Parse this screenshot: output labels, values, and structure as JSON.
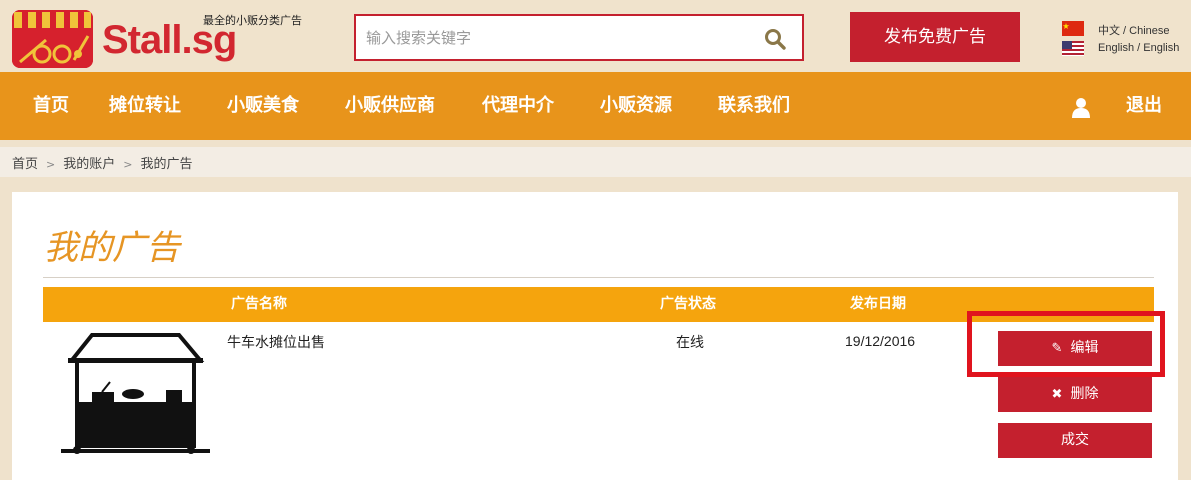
{
  "header": {
    "logo_text": "Stall.sg",
    "tagline": "最全的小贩分类广告",
    "search": {
      "placeholder": "输入搜索关键字",
      "value": ""
    },
    "post_button": "发布免费广告",
    "languages": [
      {
        "label": "中文 / Chinese",
        "flag": "china-flag-icon"
      },
      {
        "label": "English / English",
        "flag": "us-flag-icon"
      }
    ]
  },
  "nav": {
    "items": [
      "首页",
      "摊位转让",
      "小贩美食",
      "小贩供应商",
      "代理中介",
      "小贩资源",
      "联系我们"
    ],
    "logout": "退出"
  },
  "breadcrumb": [
    "首页",
    "我的账户",
    "我的广告"
  ],
  "page_title": "我的广告",
  "table": {
    "headers": [
      "广告名称",
      "广告状态",
      "发布日期"
    ],
    "rows": [
      {
        "name": "牛车水摊位出售",
        "status": "在线",
        "date": "19/12/2016",
        "actions": {
          "edit": "编辑",
          "delete": "删除",
          "done": "成交"
        }
      }
    ]
  },
  "colors": {
    "brand_red": "#c4202e",
    "nav_orange": "#e8941b",
    "table_head": "#f5a40d",
    "title_orange": "#e69524",
    "highlight_red": "#e0141e"
  }
}
